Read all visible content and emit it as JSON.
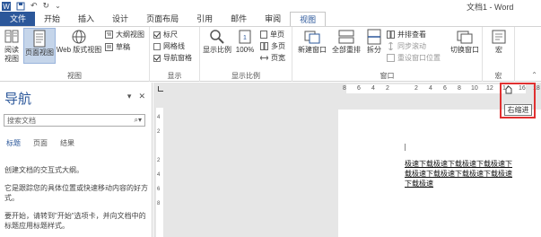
{
  "window": {
    "title": "文档1 - Word"
  },
  "qat": {
    "undo_symbol": "↶",
    "redo_symbol": "↻",
    "more_symbol": "⌄"
  },
  "tabs": [
    {
      "label": "文件"
    },
    {
      "label": "开始"
    },
    {
      "label": "插入"
    },
    {
      "label": "设计"
    },
    {
      "label": "页面布局"
    },
    {
      "label": "引用"
    },
    {
      "label": "邮件"
    },
    {
      "label": "审阅"
    },
    {
      "label": "视图"
    }
  ],
  "ribbon": {
    "views": {
      "label": "视图",
      "read_mode": "阅读\n视图",
      "print_layout": "页面视图",
      "web_layout": "Web 版式视图",
      "outline": "大纲视图",
      "draft": "草稿"
    },
    "show": {
      "label": "显示",
      "ruler": "标尺",
      "gridlines": "网格线",
      "nav_pane": "导航窗格"
    },
    "zoom": {
      "label": "显示比例",
      "zoom": "显示比例",
      "hundred": "100%",
      "one_page": "单页",
      "multi_page": "多页",
      "page_width": "页宽"
    },
    "window": {
      "label": "窗口",
      "new_window": "新建窗口",
      "arrange_all": "全部重排",
      "split": "拆分",
      "side_by_side": "并排查看",
      "sync_scroll": "同步滚动",
      "reset_position": "重设窗口位置",
      "switch_windows": "切换窗口"
    },
    "macros": {
      "label": "宏",
      "macros": "宏"
    }
  },
  "nav": {
    "title": "导航",
    "search_placeholder": "搜索文档",
    "tabs": [
      "标题",
      "页面",
      "结果"
    ],
    "para1": "创建文档的交互式大纲。",
    "para2": "它是跟踪您的具体位置或快速移动内容的好方式。",
    "para3": "要开始，请转到\"开始\"选项卡，并向文档中的标题应用标题样式。"
  },
  "ruler": {
    "numbers": [
      "8",
      "6",
      "4",
      "2",
      "2",
      "4",
      "6",
      "8",
      "10",
      "12",
      "14",
      "16",
      "18"
    ],
    "vnumbers": [
      "4",
      "2",
      "2",
      "4",
      "6",
      "8"
    ],
    "tooltip": "右缩进"
  },
  "document": {
    "text": "极速下载极速下载极速下载极速下载极速下载极速下载极速下载极速下载极速"
  },
  "colors": {
    "accent": "#2b579a",
    "highlight": "#e03030"
  }
}
